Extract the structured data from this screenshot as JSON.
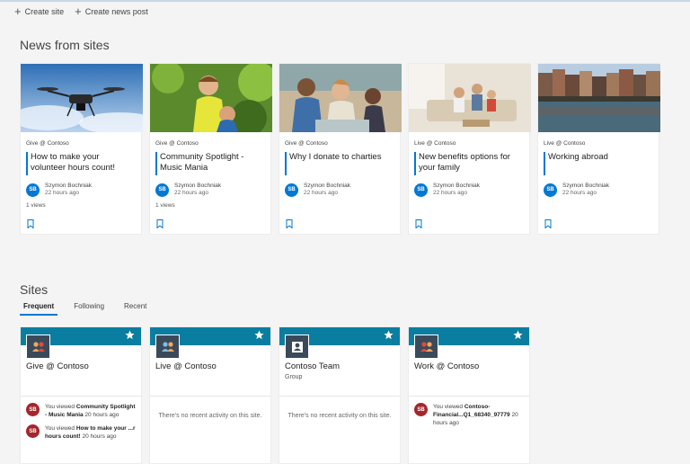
{
  "commands": {
    "create_site": "Create site",
    "create_news": "Create news post"
  },
  "news": {
    "title": "News from sites",
    "cards": [
      {
        "site": "Give @ Contoso",
        "headline": "How to make your volunteer hours count!",
        "author_initials": "SB",
        "author": "Szymon Bochniak",
        "time": "22 hours ago",
        "views": "1 views"
      },
      {
        "site": "Give @ Contoso",
        "headline": "Community Spotlight - Music Mania",
        "author_initials": "SB",
        "author": "Szymon Bochniak",
        "time": "22 hours ago",
        "views": "1 views"
      },
      {
        "site": "Give @ Contoso",
        "headline": "Why I donate to charties",
        "author_initials": "SB",
        "author": "Szymon Bochniak",
        "time": "22 hours ago",
        "views": ""
      },
      {
        "site": "Live @ Contoso",
        "headline": "New benefits options for your family",
        "author_initials": "SB",
        "author": "Szymon Bochniak",
        "time": "22 hours ago",
        "views": ""
      },
      {
        "site": "Live @ Contoso",
        "headline": "Working abroad",
        "author_initials": "SB",
        "author": "Szymon Bochniak",
        "time": "22 hours ago",
        "views": ""
      }
    ]
  },
  "sites": {
    "title": "Sites",
    "tabs": [
      "Frequent",
      "Following",
      "Recent"
    ],
    "cards": [
      {
        "name": "Give @ Contoso",
        "sub": ""
      },
      {
        "name": "Live @ Contoso",
        "sub": "",
        "no_activity": "There's no recent activity on this site."
      },
      {
        "name": "Contoso Team",
        "sub": "Group",
        "no_activity": "There's no recent activity on this site."
      },
      {
        "name": "Work @ Contoso",
        "sub": ""
      }
    ],
    "activity": {
      "initials": "SB",
      "give_1_pre": "You viewed ",
      "give_1_bold": "Community Spotlight - Music Mania",
      "give_1_time": " 20 hours ago",
      "give_2_pre": "You viewed ",
      "give_2_bold": "How to make your ...r hours count!",
      "give_2_time": " 20 hours ago",
      "work_1_pre": "You viewed ",
      "work_1_bold": "Contoso-Financial...Q1_68340_97779",
      "work_1_time": " 20 hours ago"
    }
  },
  "colors": {
    "accent": "#0078d4",
    "site_band": "#0a7ea1",
    "activity_avatar": "#a4262c"
  }
}
